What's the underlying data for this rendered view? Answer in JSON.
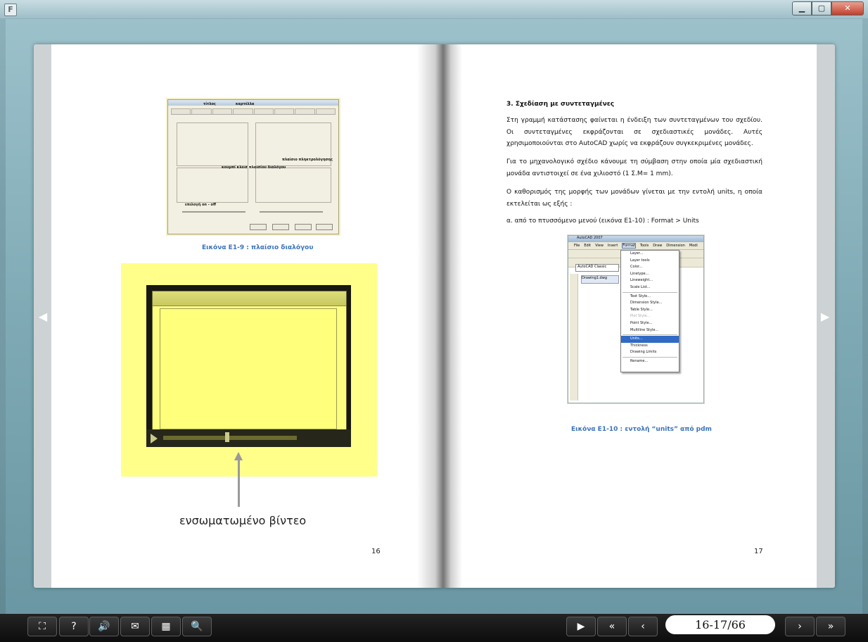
{
  "window": {
    "app_icon_letter": "F",
    "controls": {
      "minimize": "▁",
      "maximize": "▢",
      "close": "✕"
    }
  },
  "left_page": {
    "dialog_callouts": [
      "τίτλος",
      "καρτέλλα",
      "κουμπί κλεισ πλαισίου διαλόγου",
      "πλαίσιο πληκτρολόγησης",
      "επιλογή on - off"
    ],
    "figure1_caption": "Εικόνα Ε1-9 : πλαίσιο διαλόγου",
    "video_label": "ενσωματωμένο βίντεο",
    "page_number": "16"
  },
  "right_page": {
    "heading": "3.   Σχεδίαση με συντεταγμένες",
    "para1": "Στη γραμμή κατάστασης φαίνεται η ένδειξη των συντεταγμένων του σχεδίου. Οι συντεταγμένες εκφράζονται σε σχεδιαστικές μονάδες. Αυτές χρησιμοποιούνται στο AutoCAD χωρίς να εκφράζουν συγκεκριμένες μονάδες.",
    "para2": "Για το μηχανολογικό σχέδιο κάνουμε τη σύμβαση στην οποία μία σχεδιαστική μονάδα αντιστοιχεί σε ένα χιλιοστό (1 Σ.Μ= 1 mm).",
    "para3": "Ο καθορισμός της μορφής των μονάδων γίνεται με την εντολή units, η οποία εκτελείται ως εξής :",
    "para4": "α. από το πτυσσόμενο μενού (εικόνα Ε1-10) : Format > Units",
    "figure2_caption": "Εικόνα Ε1-10 : εντολή “units” από pdm",
    "page_number": "17",
    "autocad": {
      "title": "AutoCAD 2007",
      "menubar": [
        "File",
        "Edit",
        "View",
        "Insert",
        "Format",
        "Tools",
        "Draw",
        "Dimension",
        "Modi"
      ],
      "workspace": "AutoCAD Classic",
      "doc_tab": "Drawing1.dwg",
      "format_menu": [
        "Layer...",
        "Layer tools",
        "Color...",
        "Linetype...",
        "Lineweight...",
        "Scale List...",
        "Text Style...",
        "Dimension Style...",
        "Table Style...",
        "Plot Style...",
        "Point Style...",
        "Multiline Style...",
        "Units...",
        "Thickness",
        "Drawing Limits",
        "Rename..."
      ]
    }
  },
  "navigation": {
    "prev_arrow": "◀",
    "next_arrow": "▶"
  },
  "bottom_toolbar": {
    "left_buttons": [
      {
        "icon": "fit-screen-icon",
        "glyph": "⛶"
      },
      {
        "icon": "help-icon",
        "glyph": "?"
      },
      {
        "icon": "sound-icon",
        "glyph": "🔊"
      },
      {
        "icon": "email-icon",
        "glyph": "✉"
      },
      {
        "icon": "thumbnails-icon",
        "glyph": "▦"
      },
      {
        "icon": "zoom-icon",
        "glyph": "🔍"
      }
    ],
    "right_buttons": [
      {
        "icon": "play-icon",
        "glyph": "▶"
      },
      {
        "icon": "first-page-icon",
        "glyph": "«"
      },
      {
        "icon": "previous-page-icon",
        "glyph": "‹"
      },
      {
        "icon": "next-page-icon",
        "glyph": "›"
      },
      {
        "icon": "last-page-icon",
        "glyph": "»"
      }
    ],
    "page_indicator": "16-17/66"
  }
}
